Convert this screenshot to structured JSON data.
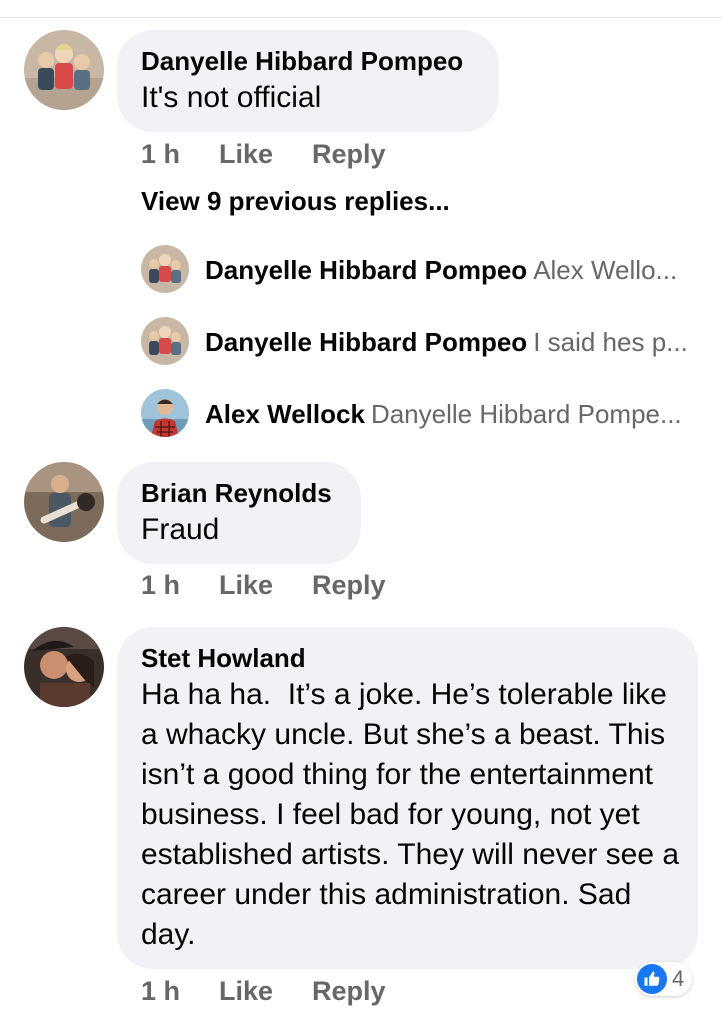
{
  "comments": [
    {
      "author": "Danyelle Hibbard Pompeo",
      "text": "It's not official",
      "time": "1 h",
      "like": "Like",
      "reply": "Reply",
      "avatar": "family-kids-avatar"
    },
    {
      "author": "Brian Reynolds",
      "text": "Fraud",
      "time": "1 h",
      "like": "Like",
      "reply": "Reply",
      "avatar": "guitarist-avatar"
    },
    {
      "author": "Stet Howland",
      "text": "Ha ha ha.  It’s a joke. He’s tolerable like a whacky uncle. But she’s a beast. This isn’t a good thing for the entertainment business. I feel bad for young, not yet established artists. They will never see a career under this administration. Sad day.",
      "time": "1 h",
      "like": "Like",
      "reply": "Reply",
      "avatar": "couple-selfie-avatar",
      "reaction": {
        "icon": "thumbs-up-icon",
        "count": "4"
      }
    }
  ],
  "replies_thread": {
    "view_previous": "View 9 previous replies...",
    "replies": [
      {
        "author": "Danyelle Hibbard Pompeo",
        "preview": "Alex Wello..."
      },
      {
        "author": "Danyelle Hibbard Pompeo",
        "preview": "I said hes p..."
      },
      {
        "author": "Alex Wellock",
        "preview": "Danyelle Hibbard Pompe..."
      }
    ]
  },
  "colors": {
    "bubble": "#f0f2f5",
    "meta_gray": "#65676b",
    "like_blue": "#1877f2"
  }
}
